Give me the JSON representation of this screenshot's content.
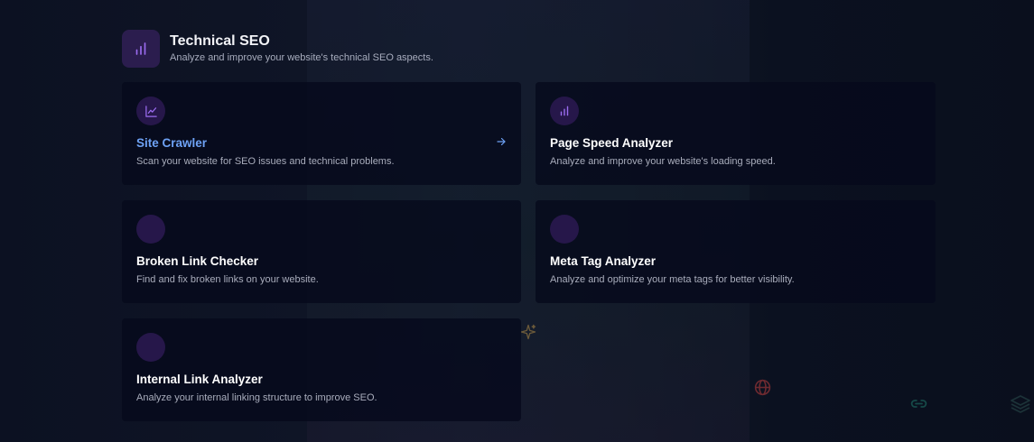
{
  "section": {
    "title": "Technical SEO",
    "subtitle": "Analyze and improve your website's technical SEO aspects.",
    "icon": "bar-chart-icon"
  },
  "cards": [
    {
      "title": "Site Crawler",
      "description": "Scan your website for SEO issues and technical problems.",
      "icon": "line-chart-icon",
      "active": true,
      "arrow_icon": "arrow-right-icon"
    },
    {
      "title": "Page Speed Analyzer",
      "description": "Analyze and improve your website's loading speed.",
      "icon": "bar-chart-icon"
    },
    {
      "title": "Broken Link Checker",
      "description": "Find and fix broken links on your website.",
      "icon": ""
    },
    {
      "title": "Meta Tag Analyzer",
      "description": "Analyze and optimize your meta tags for better visibility.",
      "icon": ""
    },
    {
      "title": "Internal Link Analyzer",
      "description": "Analyze your internal linking structure to improve SEO.",
      "icon": ""
    }
  ],
  "background_icons": [
    "sparkle-icon",
    "globe-icon",
    "link-icon",
    "layers-icon"
  ],
  "colors": {
    "accent": "#6ea2f5",
    "icon_purple": "#9b6cf0",
    "icon_bg": "#26174a",
    "card_bg": "#060a1c",
    "page_bg": "#0b1020"
  }
}
